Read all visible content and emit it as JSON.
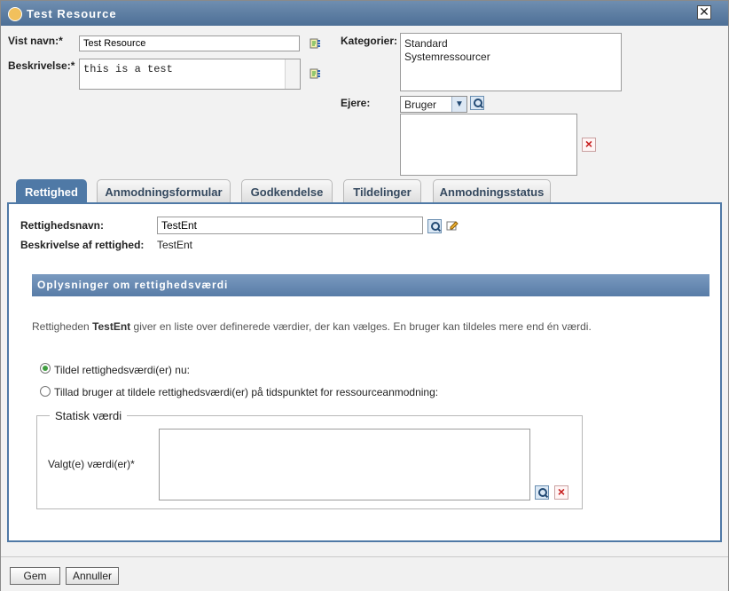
{
  "window": {
    "title": "Test Resource",
    "close_symbol": "✕"
  },
  "form": {
    "display_name_label": "Vist navn:*",
    "display_name_value": "Test Resource",
    "description_label": "Beskrivelse:*",
    "description_value": "this is a test",
    "categories_label": "Kategorier:",
    "categories": [
      "Standard",
      "Systemressourcer"
    ],
    "owners_label": "Ejere:",
    "owners_select_value": "Bruger"
  },
  "tabs": [
    {
      "label": "Rettighed"
    },
    {
      "label": "Anmodningsformular"
    },
    {
      "label": "Godkendelse"
    },
    {
      "label": "Tildelinger"
    },
    {
      "label": "Anmodningsstatus"
    }
  ],
  "entitlement": {
    "name_label": "Rettighedsnavn:",
    "name_value": "TestEnt",
    "description_label": "Beskrivelse af rettighed:",
    "description_value": "TestEnt",
    "section_title": "Oplysninger om rettighedsværdi",
    "info_prefix": "Rettigheden ",
    "info_bold": "TestEnt",
    "info_suffix": " giver en liste over definerede værdier, der kan vælges. En bruger kan tildeles mere end én værdi.",
    "radio_now": "Tildel rettighedsværdi(er) nu:",
    "radio_later": "Tillad bruger at tildele rettighedsværdi(er) på tidspunktet for ressourceanmodning:",
    "static_legend": "Statisk værdi",
    "selected_values_label": "Valgt(e) værdi(er)*"
  },
  "footer": {
    "save_label": "Gem",
    "cancel_label": "Annuller"
  },
  "colors": {
    "title_bar": "#5b7ca3",
    "accent": "#4f79a6",
    "delete": "#c61b1b"
  }
}
